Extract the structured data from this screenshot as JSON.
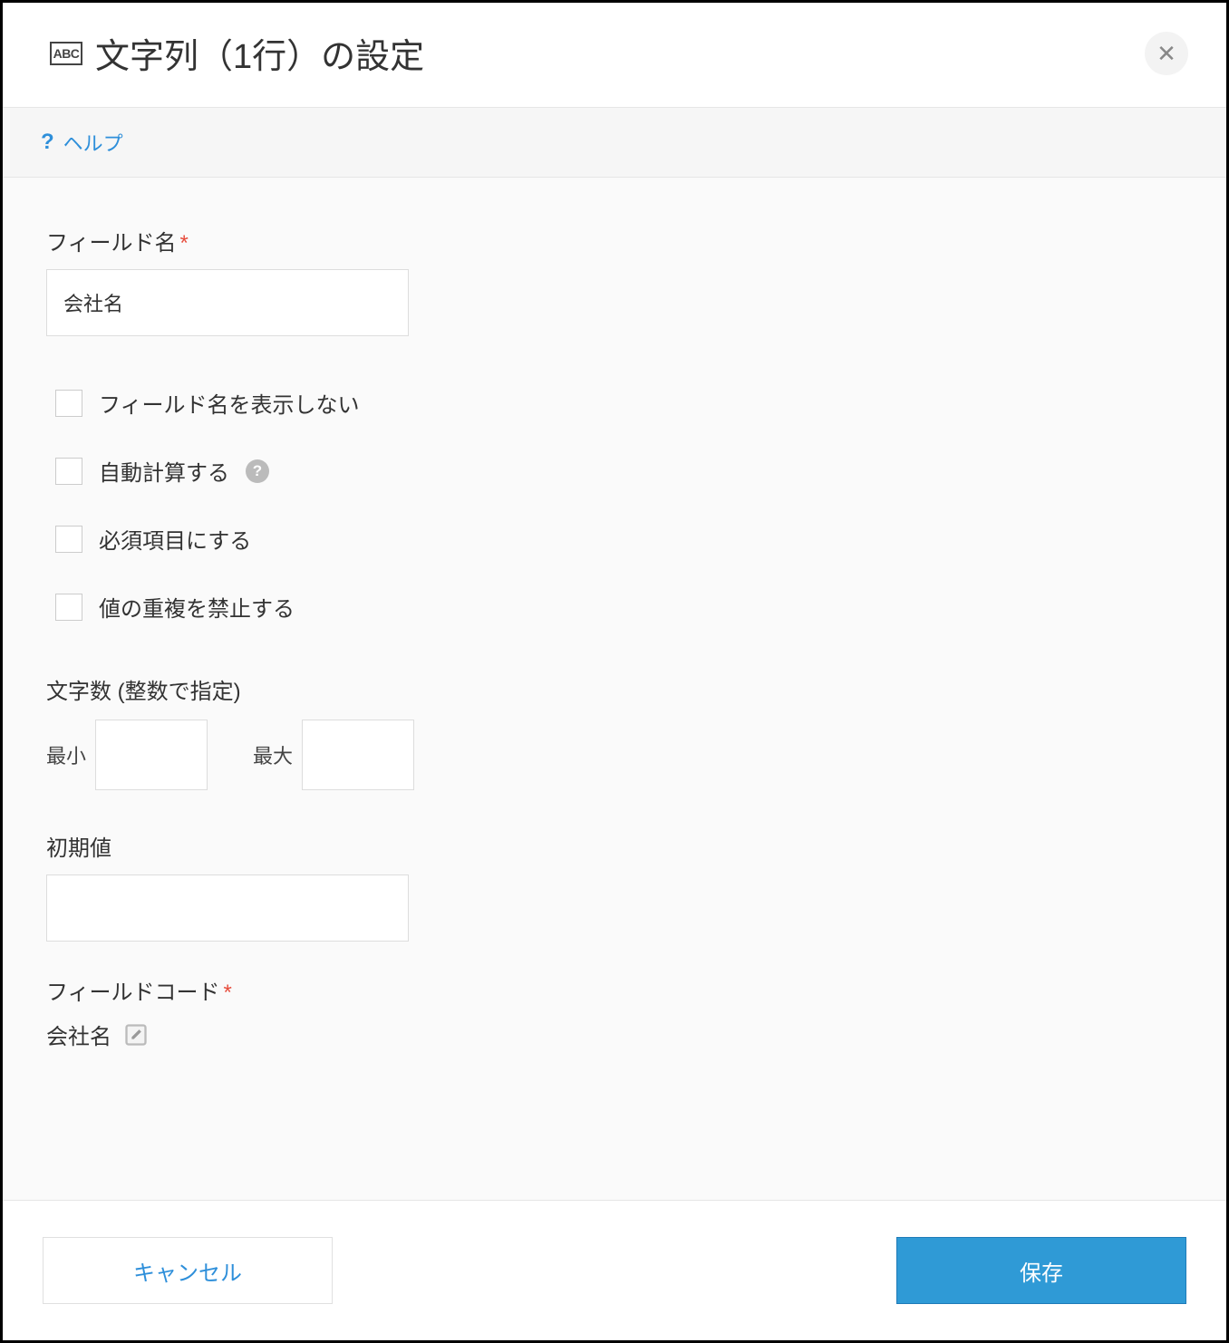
{
  "dialog": {
    "icon_label": "ABC",
    "title": "文字列（1行）の設定"
  },
  "help": {
    "label": "ヘルプ"
  },
  "form": {
    "field_name": {
      "label": "フィールド名",
      "value": "会社名"
    },
    "checkboxes": {
      "hide_field_name": "フィールド名を表示しない",
      "auto_calc": "自動計算する",
      "required": "必須項目にする",
      "no_duplicates": "値の重複を禁止する"
    },
    "char_count": {
      "label": "文字数 (整数で指定)",
      "min_label": "最小",
      "min_value": "",
      "max_label": "最大",
      "max_value": ""
    },
    "default_value": {
      "label": "初期値",
      "value": ""
    },
    "field_code": {
      "label": "フィールドコード",
      "value": "会社名"
    }
  },
  "footer": {
    "cancel": "キャンセル",
    "save": "保存"
  }
}
